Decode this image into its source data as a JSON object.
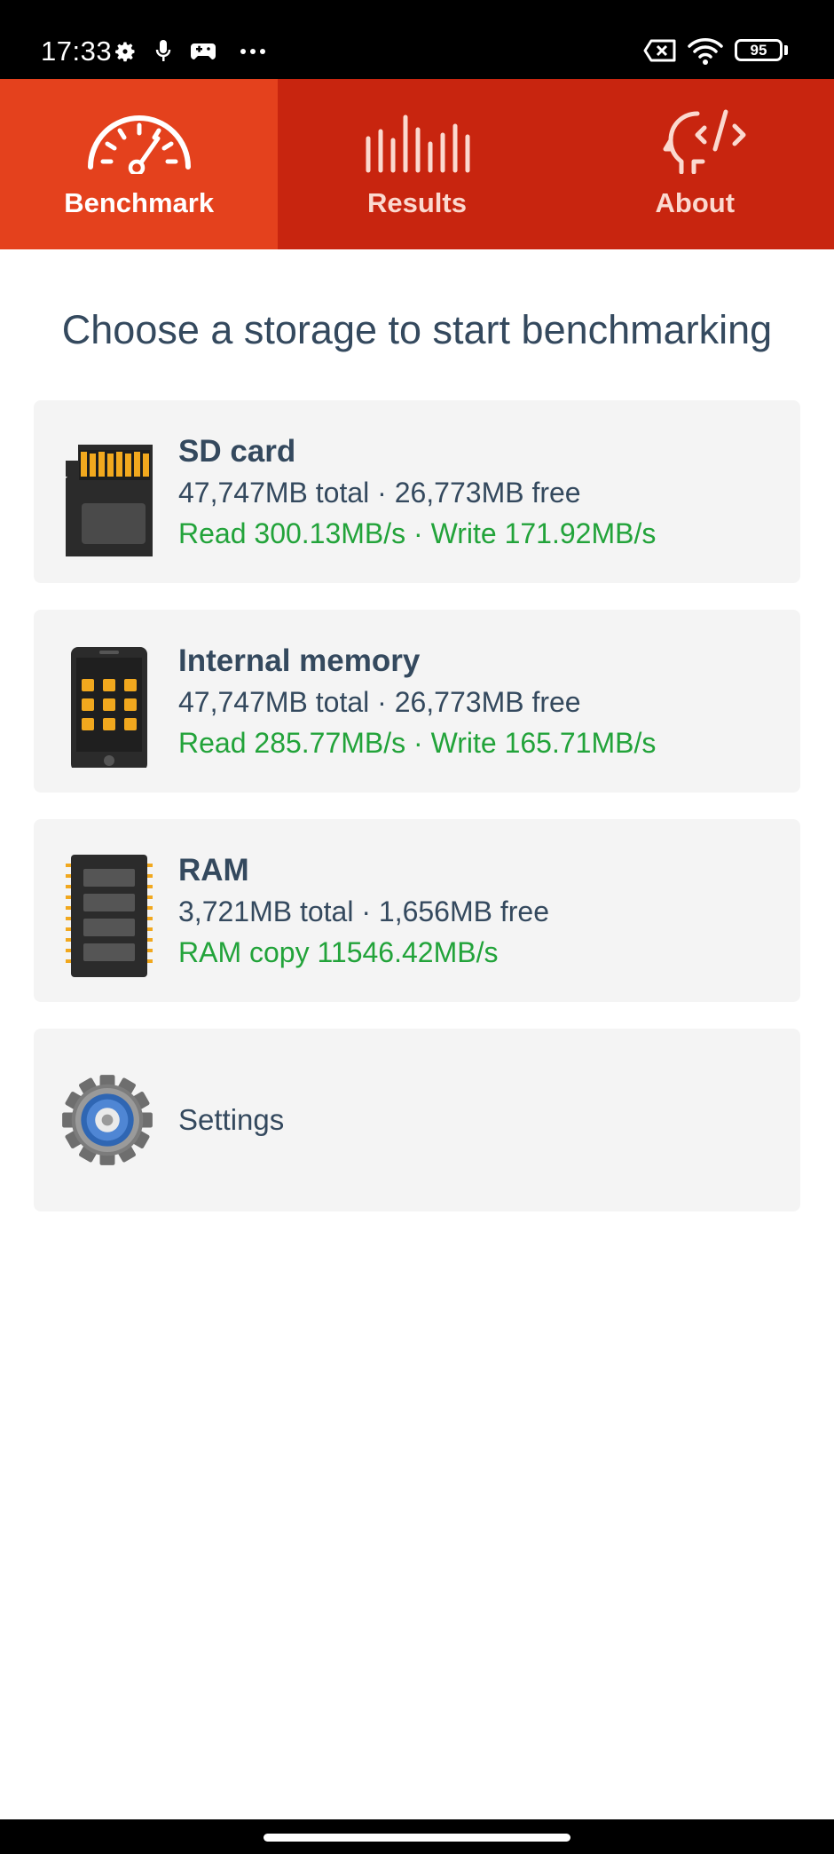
{
  "status_bar": {
    "time": "17:33",
    "icons": [
      "settings-gear-icon",
      "microphone-icon",
      "gamepad-icon",
      "more-dots-icon",
      "sim-off-icon",
      "wifi-icon"
    ],
    "battery": "95"
  },
  "tabs": [
    {
      "label": "Benchmark",
      "icon": "speedometer-icon",
      "active": true
    },
    {
      "label": "Results",
      "icon": "bar-graph-icon",
      "active": false
    },
    {
      "label": "About",
      "icon": "head-code-icon",
      "active": false
    }
  ],
  "heading": "Choose a storage to start benchmarking",
  "storages": [
    {
      "name": "SD card",
      "icon": "sd-card-icon",
      "capacity": "47,747MB total · 26,773MB free",
      "speed": "Read 300.13MB/s · Write 171.92MB/s"
    },
    {
      "name": "Internal memory",
      "icon": "phone-icon",
      "capacity": "47,747MB total · 26,773MB free",
      "speed": "Read 285.77MB/s · Write 165.71MB/s"
    },
    {
      "name": "RAM",
      "icon": "ram-chip-icon",
      "capacity": "3,721MB total · 1,656MB free",
      "speed": "RAM copy 11546.42MB/s"
    }
  ],
  "settings": {
    "label": "Settings",
    "icon": "settings-gear-icon"
  },
  "colors": {
    "tab_bar": "#c8250f",
    "tab_active": "#e4411d",
    "text_dark": "#34495e",
    "speed_green": "#22a33a",
    "card_bg": "#f4f4f4"
  }
}
